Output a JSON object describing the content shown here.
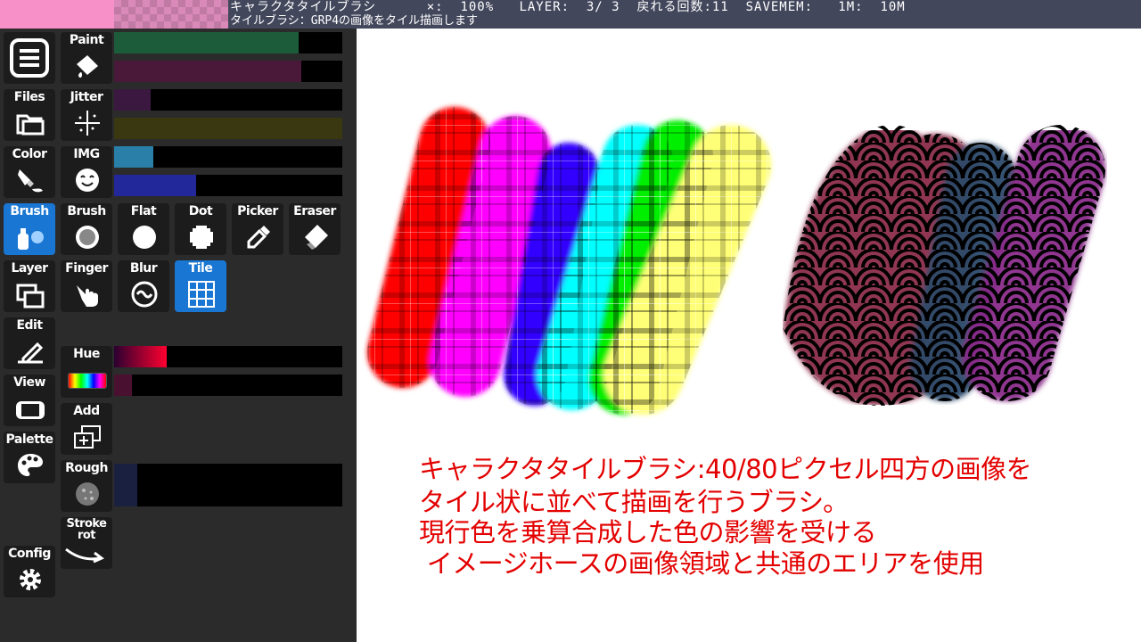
{
  "status": {
    "line1": "キャラクタタイルブラシ      ×:  100%   LAYER:  3/ 3  戻れる回数:11  SAVEMEM:   1M:  10M",
    "line2": "タイルブラシ：GRP4の画像をタイル描画します"
  },
  "colors": {
    "fg": "#f78fc8",
    "panel_bg": "#2b2b2b",
    "button_bg": "#1c1c1c",
    "selected": "#1976d2",
    "caption": "#e30000"
  },
  "sidebar": {
    "menu_icon": "hamburger-menu-icon",
    "files": "Files",
    "color": "Color",
    "brush": "Brush",
    "layer": "Layer",
    "edit": "Edit",
    "view": "View",
    "palette": "Palette",
    "config": "Config"
  },
  "tools": {
    "paint": "Paint",
    "jitter": "Jitter",
    "img": "IMG",
    "brush": "Brush",
    "flat": "Flat",
    "dot": "Dot",
    "picker": "Picker",
    "eraser": "Eraser",
    "finger": "Finger",
    "blur": "Blur",
    "tile": "Tile",
    "hue": "Hue",
    "add": "Add",
    "rough": "Rough",
    "stroke_rot": "Stroke\nrot"
  },
  "sliders": {
    "paint_a": {
      "level": 0.81,
      "color": "#1d5c3a"
    },
    "paint_b": {
      "level": 0.82,
      "color": "#4a1838"
    },
    "jitter_a": {
      "level": 0.16,
      "color": "#3a1840"
    },
    "jitter_b": {
      "level": 1.0,
      "color": "#3a3810"
    },
    "img_a": {
      "level": 0.17,
      "color": "#2a7fa8"
    },
    "img_b": {
      "level": 0.36,
      "color": "#22289a"
    },
    "hue_a": {
      "level": 0.23
    },
    "hue_b": {
      "level": 0.08,
      "color": "#4a1030"
    },
    "rough": {
      "level": 0.1,
      "color": "#1a2040"
    }
  },
  "canvas": {
    "caption_lines": [
      "キャラクタタイルブラシ:40/80ピクセル四方の画像を",
      "タイル状に並べて描画を行うブラシ。",
      "現行色を乗算合成した色の影響を受ける",
      " イメージホースの画像領域と共通のエリアを使用"
    ]
  }
}
